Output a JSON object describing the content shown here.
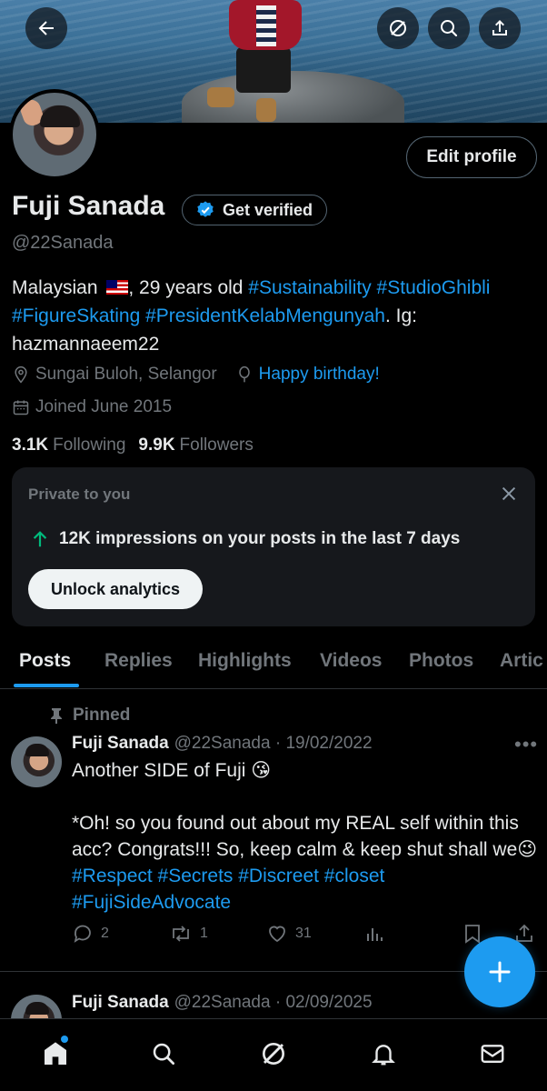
{
  "profile": {
    "name": "Fuji Sanada",
    "handle": "@22Sanada",
    "get_verified_label": "Get verified",
    "edit_profile_label": "Edit profile",
    "bio_prefix": "Malaysian",
    "bio_age": ", 29 years old ",
    "bio_tags_line1": "#Sustainability #StudioGhibli",
    "bio_tags_line2": "#FigureSkating #PresidentKelabMengunyah",
    "bio_suffix": ". Ig: hazmannaeem22",
    "location": "Sungai Buloh, Selangor",
    "birthday": "Happy birthday!",
    "joined": "Joined June 2015",
    "following_count": "3.1K",
    "following_label": "Following",
    "followers_count": "9.9K",
    "followers_label": "Followers"
  },
  "private_card": {
    "title": "Private to you",
    "impressions": "12K impressions on your posts in the last 7 days",
    "unlock_label": "Unlock analytics"
  },
  "tabs": [
    {
      "label": "Posts",
      "active": true
    },
    {
      "label": "Replies"
    },
    {
      "label": "Highlights"
    },
    {
      "label": "Videos"
    },
    {
      "label": "Photos"
    },
    {
      "label": "Artic"
    }
  ],
  "posts": [
    {
      "pinned_label": "Pinned",
      "author": "Fuji Sanada",
      "meta": "@22Sanada · 19/02/2022",
      "line1": "Another SIDE of Fuji 😘",
      "line2": "*Oh! so you found out about my REAL self within this acc? Congrats!!! So, keep calm & keep shut shall we😉 ",
      "tags": "#Respect #Secrets #Discreet #closet #FujiSideAdvocate",
      "replies": "2",
      "reposts": "1",
      "likes": "31"
    },
    {
      "author": "Fuji Sanada",
      "meta": "@22Sanada · 02/09/2025"
    }
  ],
  "colors": {
    "accent": "#1d9bf0",
    "background": "#000000",
    "muted": "#71767b",
    "text": "#e7e9ea",
    "card": "#16181c",
    "impressions_arrow": "#00ba7c"
  },
  "icons": {
    "back": "arrow-left-icon",
    "grok": "grok-icon",
    "search": "search-icon",
    "share": "share-icon",
    "verified": "verified-badge-icon",
    "location": "location-pin-icon",
    "birthday": "balloon-icon",
    "calendar": "calendar-icon",
    "close": "close-icon",
    "arrow_up": "arrow-up-icon",
    "pin": "pin-icon",
    "reply": "reply-icon",
    "repost": "repost-icon",
    "like": "heart-icon",
    "views": "analytics-icon",
    "bookmark": "bookmark-icon",
    "compose": "plus-icon",
    "home": "home-icon",
    "notifications": "bell-icon",
    "messages": "mail-icon"
  }
}
